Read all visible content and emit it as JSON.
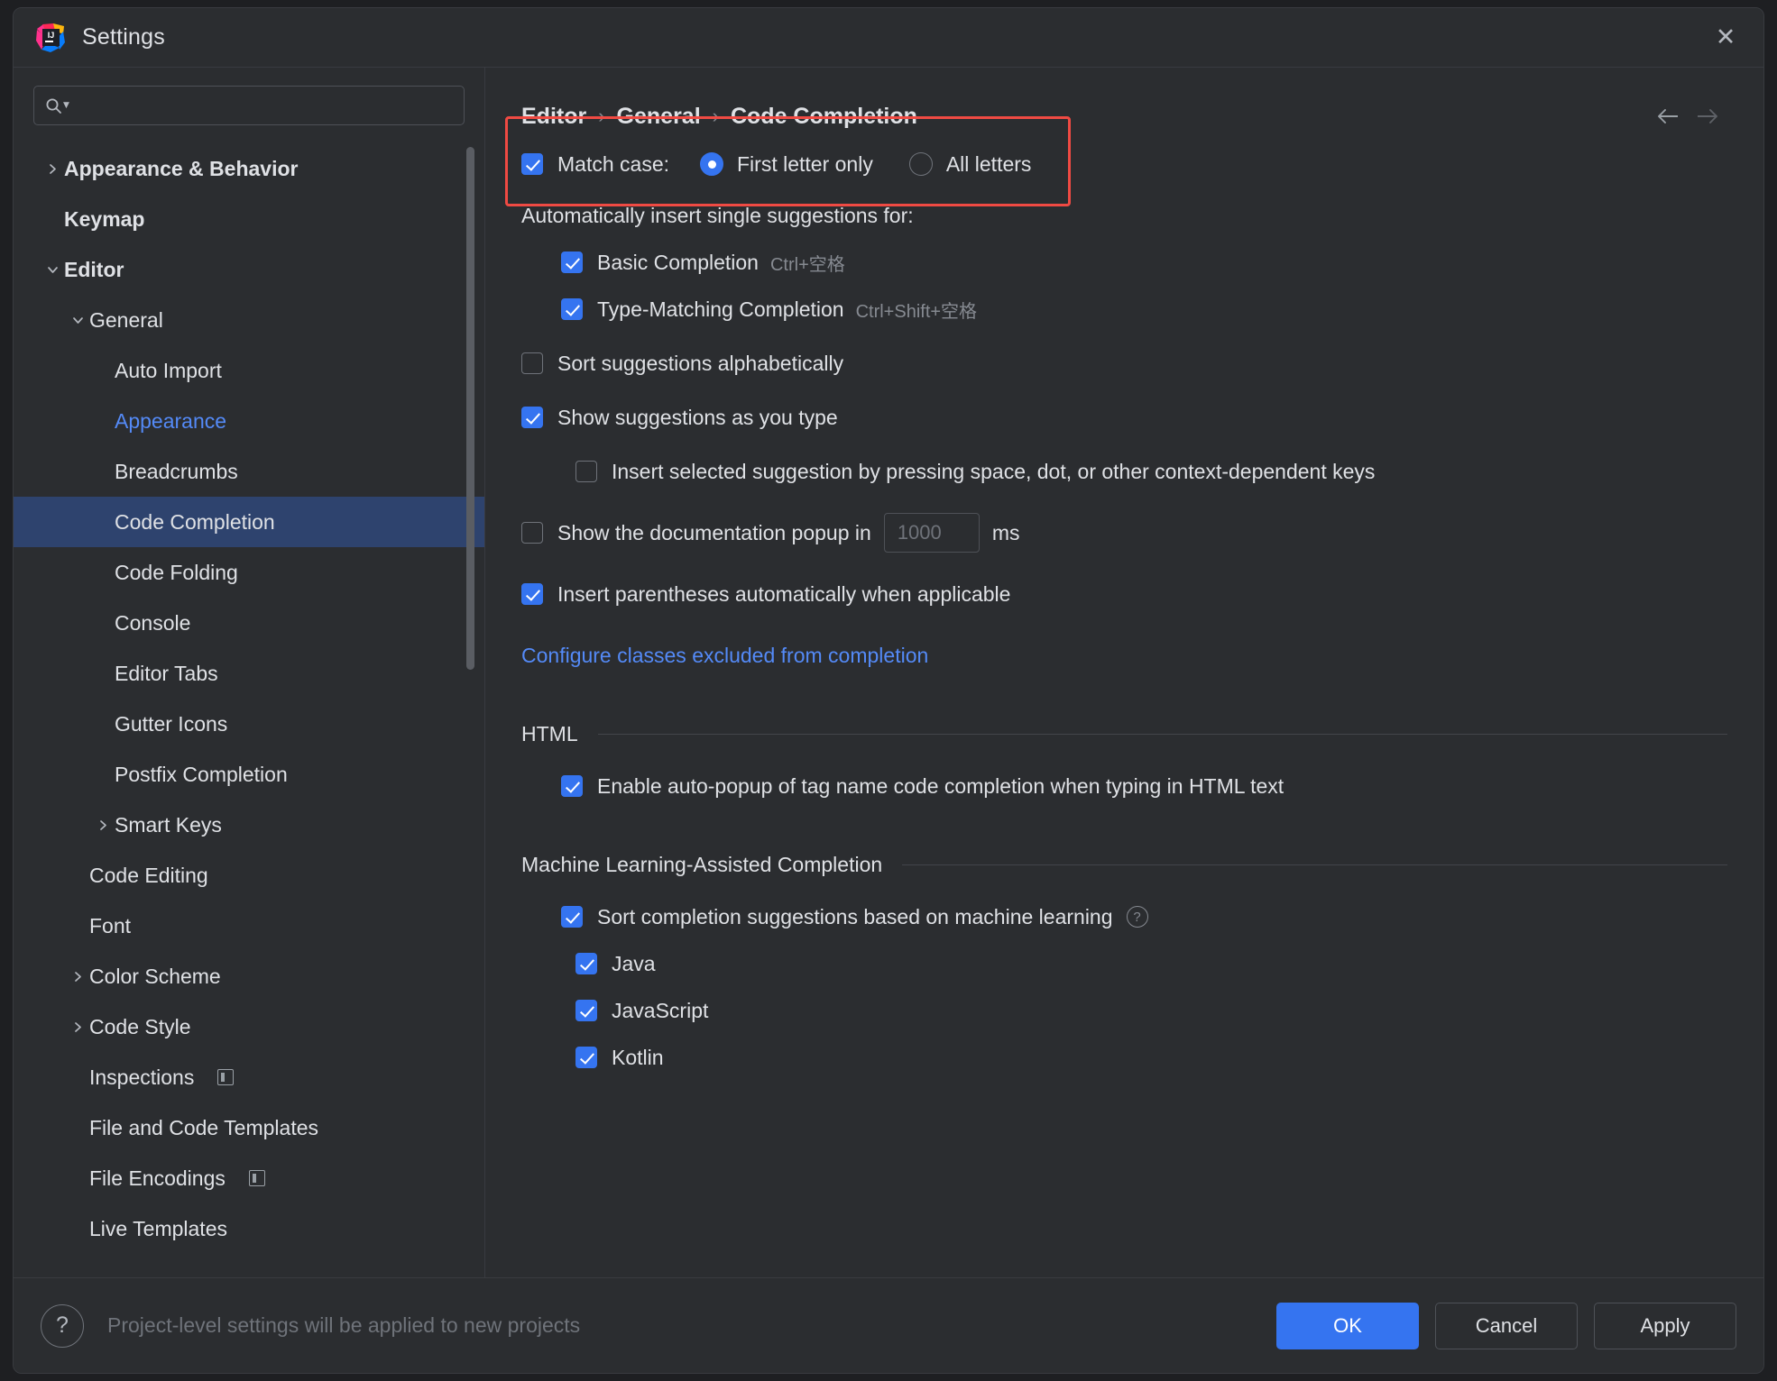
{
  "window": {
    "title": "Settings",
    "logo_icon": "intellij-idea-logo",
    "close_icon": "close-icon"
  },
  "search": {
    "placeholder": "",
    "value": "",
    "icon": "search-icon",
    "dropdown_icon": "chevron-down-icon"
  },
  "sidebar": {
    "items": [
      {
        "label": "Appearance & Behavior",
        "indent": 0,
        "arrow": "chevron-right-icon",
        "bold": true,
        "selected": false,
        "modified": false,
        "badge": false
      },
      {
        "label": "Keymap",
        "indent": 0,
        "arrow": "none",
        "bold": true,
        "selected": false,
        "modified": false,
        "badge": false
      },
      {
        "label": "Editor",
        "indent": 0,
        "arrow": "chevron-down-icon",
        "bold": true,
        "selected": false,
        "modified": false,
        "badge": false
      },
      {
        "label": "General",
        "indent": 1,
        "arrow": "chevron-down-icon",
        "bold": false,
        "selected": false,
        "modified": false,
        "badge": false
      },
      {
        "label": "Auto Import",
        "indent": 2,
        "arrow": "none",
        "bold": false,
        "selected": false,
        "modified": false,
        "badge": false
      },
      {
        "label": "Appearance",
        "indent": 2,
        "arrow": "none",
        "bold": false,
        "selected": false,
        "modified": true,
        "badge": false
      },
      {
        "label": "Breadcrumbs",
        "indent": 2,
        "arrow": "none",
        "bold": false,
        "selected": false,
        "modified": false,
        "badge": false
      },
      {
        "label": "Code Completion",
        "indent": 2,
        "arrow": "none",
        "bold": false,
        "selected": true,
        "modified": false,
        "badge": false
      },
      {
        "label": "Code Folding",
        "indent": 2,
        "arrow": "none",
        "bold": false,
        "selected": false,
        "modified": false,
        "badge": false
      },
      {
        "label": "Console",
        "indent": 2,
        "arrow": "none",
        "bold": false,
        "selected": false,
        "modified": false,
        "badge": false
      },
      {
        "label": "Editor Tabs",
        "indent": 2,
        "arrow": "none",
        "bold": false,
        "selected": false,
        "modified": false,
        "badge": false
      },
      {
        "label": "Gutter Icons",
        "indent": 2,
        "arrow": "none",
        "bold": false,
        "selected": false,
        "modified": false,
        "badge": false
      },
      {
        "label": "Postfix Completion",
        "indent": 2,
        "arrow": "none",
        "bold": false,
        "selected": false,
        "modified": false,
        "badge": false
      },
      {
        "label": "Smart Keys",
        "indent": 2,
        "arrow": "chevron-right-icon",
        "bold": false,
        "selected": false,
        "modified": false,
        "badge": false
      },
      {
        "label": "Code Editing",
        "indent": 1,
        "arrow": "none",
        "bold": false,
        "selected": false,
        "modified": false,
        "badge": false
      },
      {
        "label": "Font",
        "indent": 1,
        "arrow": "none",
        "bold": false,
        "selected": false,
        "modified": false,
        "badge": false
      },
      {
        "label": "Color Scheme",
        "indent": 1,
        "arrow": "chevron-right-icon",
        "bold": false,
        "selected": false,
        "modified": false,
        "badge": false
      },
      {
        "label": "Code Style",
        "indent": 1,
        "arrow": "chevron-right-icon",
        "bold": false,
        "selected": false,
        "modified": false,
        "badge": false
      },
      {
        "label": "Inspections",
        "indent": 1,
        "arrow": "none",
        "bold": false,
        "selected": false,
        "modified": false,
        "badge": true
      },
      {
        "label": "File and Code Templates",
        "indent": 1,
        "arrow": "none",
        "bold": false,
        "selected": false,
        "modified": false,
        "badge": false
      },
      {
        "label": "File Encodings",
        "indent": 1,
        "arrow": "none",
        "bold": false,
        "selected": false,
        "modified": false,
        "badge": true
      },
      {
        "label": "Live Templates",
        "indent": 1,
        "arrow": "none",
        "bold": false,
        "selected": false,
        "modified": false,
        "badge": false
      }
    ]
  },
  "breadcrumb": {
    "items": [
      "Editor",
      "General",
      "Code Completion"
    ],
    "separator": "›",
    "back_icon": "arrow-left-icon",
    "forward_icon": "arrow-right-icon"
  },
  "main": {
    "match_case": {
      "label": "Match case:",
      "checked": true,
      "options": [
        {
          "label": "First letter only",
          "selected": true
        },
        {
          "label": "All letters",
          "selected": false
        }
      ],
      "highlight_color": "#f04a43"
    },
    "auto_insert_header": "Automatically insert single suggestions for:",
    "auto_insert_items": [
      {
        "label": "Basic Completion",
        "shortcut": "Ctrl+空格",
        "checked": true
      },
      {
        "label": "Type-Matching Completion",
        "shortcut": "Ctrl+Shift+空格",
        "checked": true
      }
    ],
    "sort_alphabetically": {
      "label": "Sort suggestions alphabetically",
      "checked": false
    },
    "show_as_you_type": {
      "label": "Show suggestions as you type",
      "checked": true
    },
    "insert_on_keys": {
      "label": "Insert selected suggestion by pressing space, dot, or other context-dependent keys",
      "checked": false
    },
    "doc_popup": {
      "label_before": "Show the documentation popup in",
      "value": "1000",
      "label_after": "ms",
      "checked": false
    },
    "insert_parens": {
      "label": "Insert parentheses automatically when applicable",
      "checked": true
    },
    "configure_link": "Configure classes excluded from completion",
    "html_section": {
      "title": "HTML",
      "items": [
        {
          "label": "Enable auto-popup of tag name code completion when typing in HTML text",
          "checked": true
        }
      ]
    },
    "ml_section": {
      "title": "Machine Learning-Assisted Completion",
      "main_item": {
        "label": "Sort completion suggestions based on machine learning",
        "checked": true,
        "help_icon": "question-mark-icon"
      },
      "languages": [
        {
          "label": "Java",
          "checked": true
        },
        {
          "label": "JavaScript",
          "checked": true
        },
        {
          "label": "Kotlin",
          "checked": true
        }
      ]
    }
  },
  "footer": {
    "help_icon": "question-mark-icon",
    "note": "Project-level settings will be applied to new projects",
    "buttons": [
      {
        "label": "OK",
        "primary": true
      },
      {
        "label": "Cancel",
        "primary": false
      },
      {
        "label": "Apply",
        "primary": false
      }
    ]
  }
}
